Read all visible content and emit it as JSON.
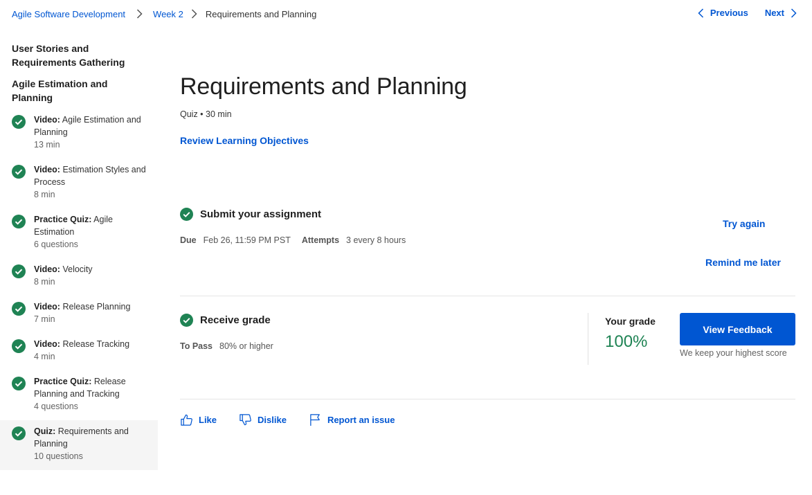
{
  "breadcrumb": {
    "course": "Agile Software Development",
    "week": "Week 2",
    "current": "Requirements and Planning"
  },
  "pager": {
    "previous": "Previous",
    "next": "Next"
  },
  "sidebar": {
    "section1": "User Stories and Requirements Gathering",
    "section2": "Agile Estimation and Planning",
    "items": [
      {
        "type": "Video:",
        "title": "Agile Estimation and Planning",
        "meta": "13 min"
      },
      {
        "type": "Video:",
        "title": "Estimation Styles and Process",
        "meta": "8 min"
      },
      {
        "type": "Practice Quiz:",
        "title": "Agile Estimation",
        "meta": "6 questions"
      },
      {
        "type": "Video:",
        "title": "Velocity",
        "meta": "8 min"
      },
      {
        "type": "Video:",
        "title": "Release Planning",
        "meta": "7 min"
      },
      {
        "type": "Video:",
        "title": "Release Tracking",
        "meta": "4 min"
      },
      {
        "type": "Practice Quiz:",
        "title": "Release Planning and Tracking",
        "meta": "4 questions"
      },
      {
        "type": "Quiz:",
        "title": "Requirements and Planning",
        "meta": "10 questions"
      }
    ]
  },
  "main": {
    "title": "Requirements and Planning",
    "subtitle": "Quiz • 30 min",
    "review_link": "Review Learning Objectives",
    "submit": {
      "heading": "Submit your assignment",
      "due_label": "Due",
      "due_value": "Feb 26, 11:59 PM PST",
      "attempts_label": "Attempts",
      "attempts_value": "3 every 8 hours",
      "try_again": "Try again",
      "remind_later": "Remind me later"
    },
    "grade": {
      "heading": "Receive grade",
      "to_pass_label": "To Pass",
      "to_pass_value": "80% or higher",
      "your_grade_label": "Your grade",
      "your_grade_value": "100%",
      "view_feedback": "View Feedback",
      "keep_note": "We keep your highest score"
    },
    "footer": {
      "like": "Like",
      "dislike": "Dislike",
      "report": "Report an issue"
    }
  },
  "colors": {
    "accent": "#0056d2",
    "success": "#1f8354",
    "text": "#1f1f1f"
  }
}
